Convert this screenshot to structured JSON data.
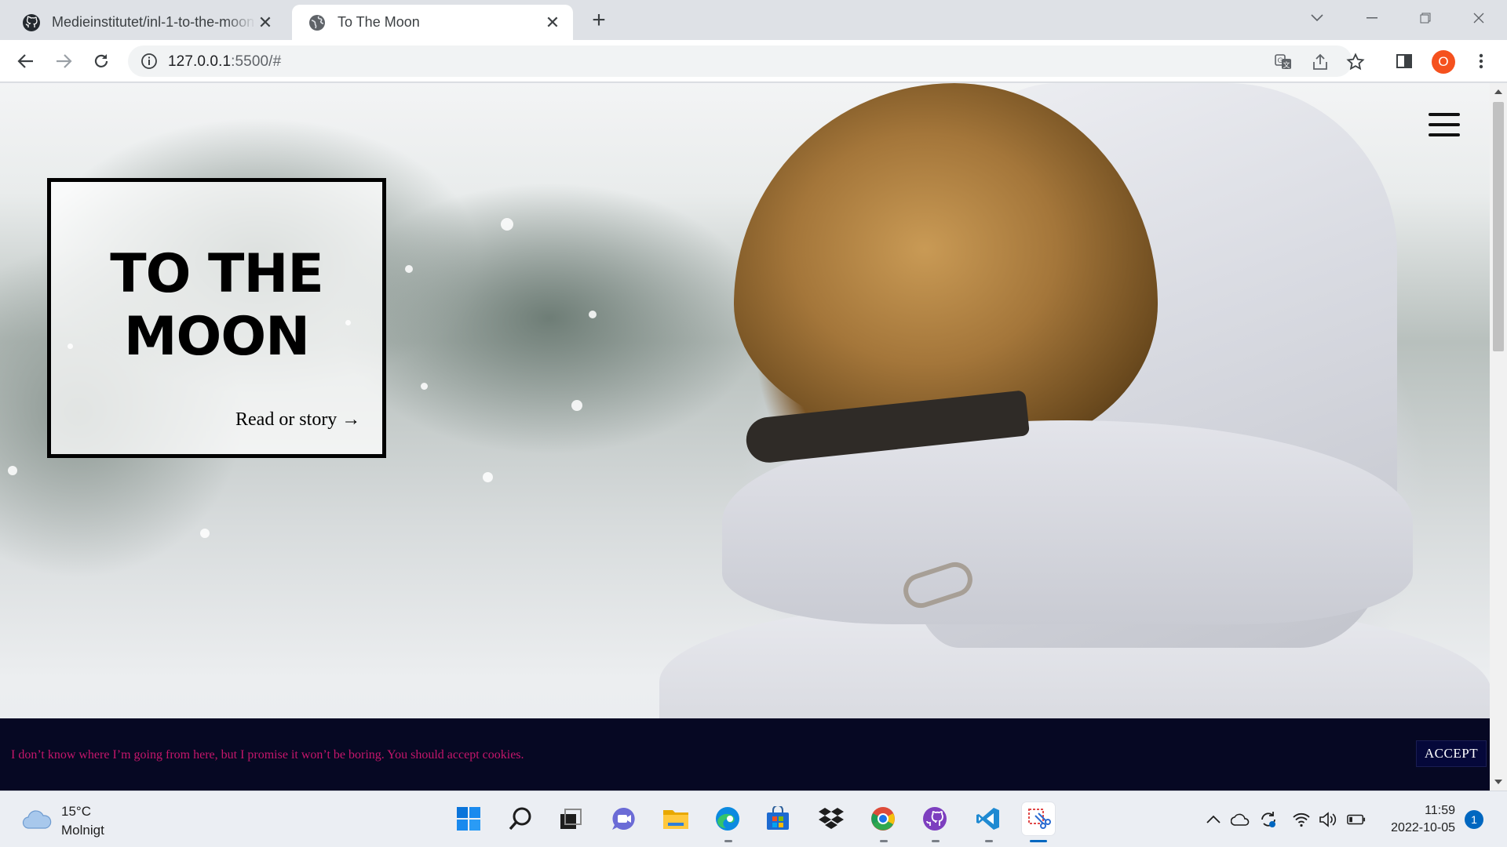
{
  "browser": {
    "tabs": [
      {
        "title": "Medieinstitutet/inl-1-to-the-moon",
        "favicon": "github-icon",
        "active": false
      },
      {
        "title": "To The Moon",
        "favicon": "globe-icon",
        "active": true
      }
    ],
    "url_host": "127.0.0.1",
    "url_rest": ":5500/#",
    "profile_initial": "O"
  },
  "page": {
    "title": "TO THE MOON",
    "read_link": "Read or story →",
    "cookie": {
      "message": "I don’t know where I’m going from here, but I promise it won’t be boring. You should accept cookies.",
      "accept_label": "ACCEPT"
    }
  },
  "taskbar": {
    "weather": {
      "temp": "15°C",
      "condition": "Molnigt"
    },
    "apps": [
      "windows-start",
      "search",
      "task-view",
      "teams-chat",
      "file-explorer",
      "edge",
      "microsoft-store",
      "dropbox",
      "chrome",
      "github-desktop",
      "vs-code",
      "snipping-tool"
    ],
    "clock": {
      "time": "11:59",
      "date": "2022-10-05"
    },
    "notifications": "1"
  },
  "colors": {
    "cookie_bg": "#060823",
    "cookie_text": "#c5166b",
    "accept_bg": "#05083a",
    "profile": "#f5511e"
  }
}
